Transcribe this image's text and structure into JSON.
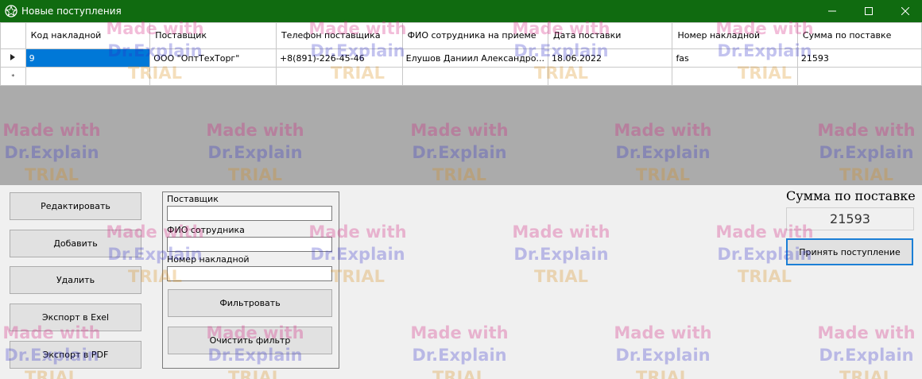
{
  "window": {
    "title": "Новые поступления",
    "accent_color": "#106b10"
  },
  "grid": {
    "columns": [
      "Код накладной",
      "Поставщик",
      "Телефон поставщика",
      "ФИО сотрудника на приеме",
      "Дата поставки",
      "Номер накладной",
      "Сумма по поставке"
    ],
    "rows": [
      {
        "selected": true,
        "cells": [
          "9",
          "ООО \"ОптТехТорг\"",
          "+8(891)-226-45-46",
          "Елушов Даниил Александро...",
          "18.06.2022",
          "fas",
          "21593"
        ]
      }
    ],
    "new_row_marker": "*"
  },
  "actions": {
    "edit": "Редактировать",
    "add": "Добавить",
    "delete": "Удалить",
    "export_excel": "Экспорт в Exel",
    "export_pdf": "Экспорт в PDF"
  },
  "filter": {
    "supplier_label": "Поставщик",
    "supplier_value": "",
    "employee_label": "ФИО сотрудника",
    "employee_value": "",
    "invoice_label": "Номер накладной",
    "invoice_value": "",
    "apply": "Фильтровать",
    "clear": "Очистить фильтр"
  },
  "summary": {
    "caption": "Сумма по поставке",
    "value": "21593",
    "accept": "Принять поступление"
  },
  "watermark": {
    "line1": "Made with",
    "line2": "Dr.Explain",
    "line3": "TRIAL"
  }
}
